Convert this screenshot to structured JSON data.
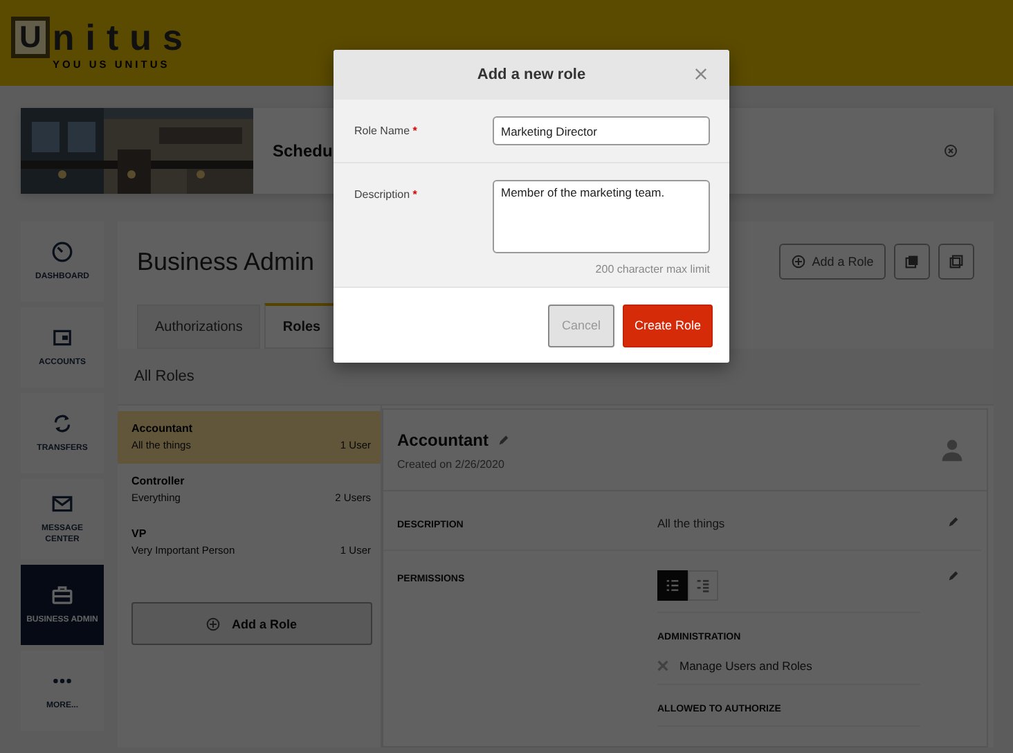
{
  "header": {
    "logo_mark": "U",
    "logo_name": "nitus",
    "tagline": "YOU US UNITUS"
  },
  "banner": {
    "title": "Schedu"
  },
  "sidebar": {
    "items": [
      {
        "label": "DASHBOARD",
        "selected": false
      },
      {
        "label": "ACCOUNTS",
        "selected": false
      },
      {
        "label": "TRANSFERS",
        "selected": false
      },
      {
        "label": "MESSAGE CENTER",
        "selected": false
      },
      {
        "label": "BUSINESS ADMIN",
        "selected": true
      },
      {
        "label": "MORE...",
        "selected": false
      }
    ]
  },
  "page": {
    "title": "Business Admin",
    "add_button": "Add a Role"
  },
  "tabs": [
    {
      "label": "Authorizations",
      "selected": false
    },
    {
      "label": "Roles",
      "selected": true
    }
  ],
  "roles_header": "All Roles",
  "roles": [
    {
      "name": "Accountant",
      "description": "All the things",
      "users": "1 User",
      "selected": true
    },
    {
      "name": "Controller",
      "description": "Everything",
      "users": "2 Users",
      "selected": false
    },
    {
      "name": "VP",
      "description": "Very Important Person",
      "users": "1 User",
      "selected": false
    }
  ],
  "add_role_button": "Add a Role",
  "detail": {
    "name": "Accountant",
    "created": "Created on 2/26/2020",
    "description_label": "DESCRIPTION",
    "description": "All the things",
    "permissions_label": "PERMISSIONS",
    "view_toggle": [
      {
        "selected": true
      },
      {
        "selected": false
      }
    ],
    "groups": [
      {
        "title": "ADMINISTRATION",
        "items": [
          {
            "label": "Manage Users and Roles",
            "allowed": false
          }
        ]
      },
      {
        "title": "ALLOWED TO AUTHORIZE"
      }
    ]
  },
  "modal": {
    "title": "Add a new role",
    "required_mark": "*",
    "fields": [
      {
        "label": "Role Name",
        "required": true,
        "value": "Marketing Director",
        "kind": "input"
      },
      {
        "label": "Description",
        "required": true,
        "value": "Member of the marketing team.",
        "kind": "textarea"
      }
    ],
    "hint": "200 character max limit",
    "buttons": [
      {
        "label": "Cancel",
        "kind": "secondary"
      },
      {
        "label": "Create Role",
        "kind": "primary"
      }
    ]
  }
}
